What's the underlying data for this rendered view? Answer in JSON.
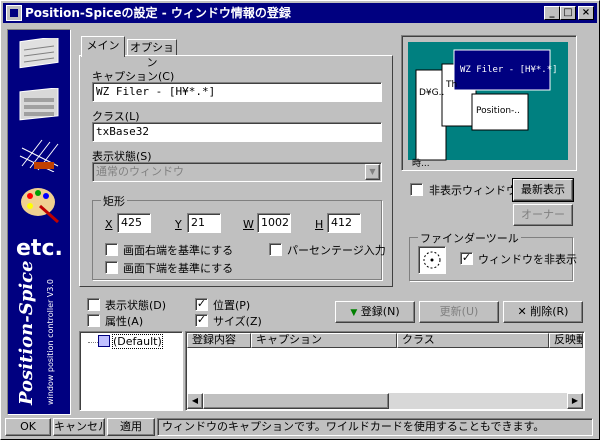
{
  "window": {
    "title": "Position-Spiceの設定 - ウィンドウ情報の登録"
  },
  "colors": {
    "titlebar": "#000080",
    "face": "#c0c0c0",
    "preview_bg": "#008080",
    "sidebar": "#000080"
  },
  "sidebar": {
    "icons": [
      "window-layout-icon",
      "window-list-icon",
      "grid-pattern-icon",
      "palette-icon"
    ],
    "etc_label": "etc.",
    "brand_title": "Position-Spice",
    "brand_sub": "window position controller V3.0"
  },
  "tabs": [
    {
      "label": "メイン"
    },
    {
      "label": "オプション"
    }
  ],
  "main": {
    "caption_label": "キャプション(C)",
    "caption_value": "WZ Filer - [H¥*.*]",
    "class_label": "クラス(L)",
    "class_value": "txBase32",
    "display_state_label": "表示状態(S)",
    "display_state_value": "通常のウィンドウ",
    "rect": {
      "label": "矩形",
      "x_label": "X",
      "x_value": "425",
      "y_label": "Y",
      "y_value": "21",
      "w_label": "W",
      "w_value": "1002",
      "h_label": "H",
      "h_value": "412",
      "right_edge_label": "画面右端を基準にする",
      "bottom_edge_label": "画面下端を基準にする",
      "percentage_label": "パーセンテージ入力"
    }
  },
  "preview": {
    "windows": [
      "WZ Filer - [H¥*.*]",
      "D¥G..",
      "Th",
      "Position-..",
      "時..."
    ]
  },
  "right_controls": {
    "hide_window_label": "非表示ウィンドウ",
    "refresh_label": "最新表示",
    "owner_label": "オーナー",
    "finder_label": "ファインダーツール",
    "hide_window_finder_label": "ウィンドウを非表示",
    "hide_window_finder_checked": true
  },
  "register_options": {
    "display_state": {
      "label": "表示状態(D)",
      "checked": false
    },
    "attribute": {
      "label": "属性(A)",
      "checked": false
    },
    "position": {
      "label": "位置(P)",
      "checked": true
    },
    "size": {
      "label": "サイズ(Z)",
      "checked": true
    }
  },
  "actions": {
    "register": "登録(N)",
    "update": "更新(U)",
    "delete": "削除(R)"
  },
  "tree": {
    "items": [
      "(Default)"
    ]
  },
  "list": {
    "columns": [
      "登録内容",
      "キャプション",
      "クラス",
      "反映動"
    ]
  },
  "statusbar": {
    "ok": "OK",
    "cancel": "キャンセル",
    "apply": "適用",
    "message": "ウィンドウのキャプションです。ワイルドカードを使用することもできます。"
  }
}
